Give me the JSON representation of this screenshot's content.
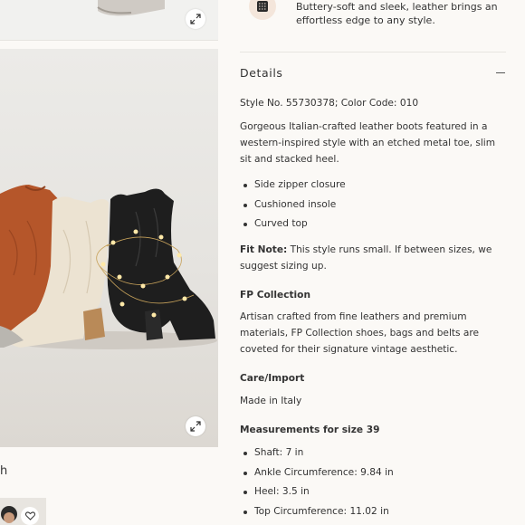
{
  "product": {
    "promo_text": "Buttery-soft and sleek, leather brings an effortless edge to any style."
  },
  "left": {
    "partial_text": "h"
  },
  "details": {
    "title": "Details",
    "style_line": "Style No. 55730378; Color Code: 010",
    "description": "Gorgeous Italian-crafted leather boots featured in a western-inspired style with an etched metal toe, slim sit and stacked heel.",
    "features": [
      "Side zipper closure",
      "Cushioned insole",
      "Curved top"
    ],
    "fit_note_label": "Fit Note:",
    "fit_note_text": " This style runs small. If between sizes, we suggest sizing up.",
    "collection_title": "FP Collection",
    "collection_text": "Artisan crafted from fine leathers and premium materials, FP Collection shoes, bags and belts are coveted for their signature vintage aesthetic.",
    "care_title": "Care/Import",
    "care_text": "Made in Italy",
    "measurements_title": "Measurements for size 39",
    "measurements": [
      "Shaft: 7 in",
      "Ankle Circumference: 9.84 in",
      "Heel: 3.5 in",
      "Top Circumference: 11.02 in"
    ]
  },
  "icons": {
    "expand": "expand-icon",
    "heart": "heart-icon",
    "collapse": "minus-icon",
    "material": "leather-swatch-icon"
  },
  "colors": {
    "background": "#fbf9f6",
    "boot_rust": "#b5562a",
    "boot_cream": "#ece3d2",
    "boot_black": "#1e1e1e",
    "text": "#333333"
  }
}
